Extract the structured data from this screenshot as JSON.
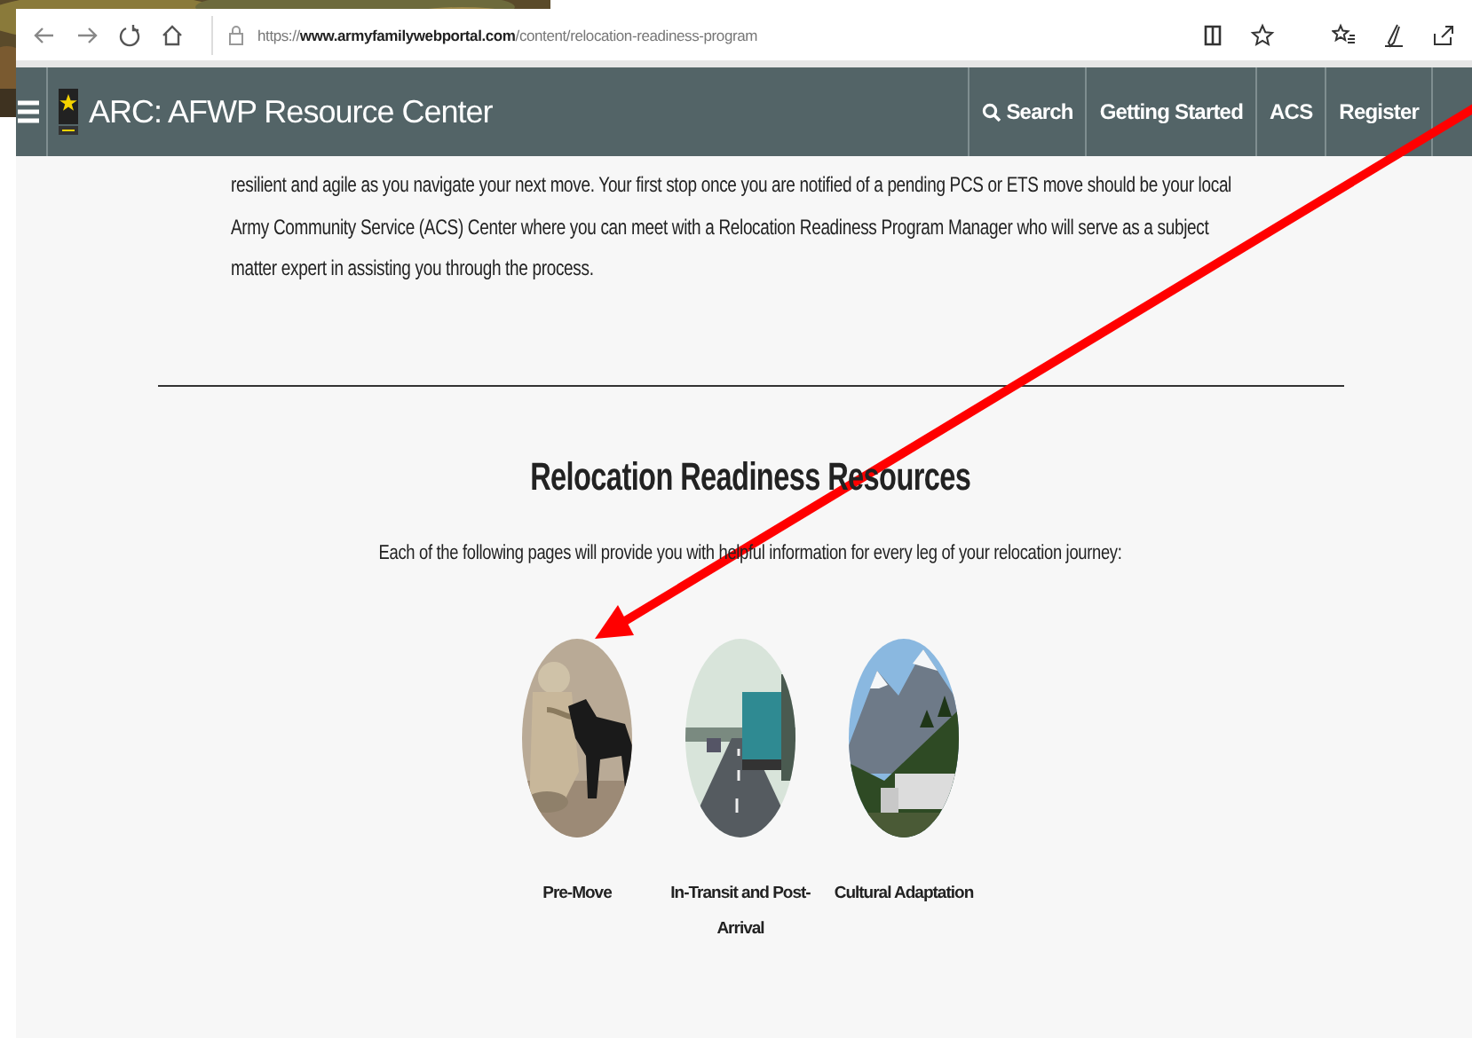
{
  "browser": {
    "url": "https://**www.armyfamilywebportal.com**/content/relocation-readiness-program"
  },
  "nav": {
    "title": "ARC: AFWP Resource Center",
    "links": [
      {
        "label": "Search",
        "kind": "search"
      },
      {
        "label": "Getting Started",
        "kind": "link"
      },
      {
        "label": "ACS",
        "kind": "link"
      },
      {
        "label": "Register",
        "kind": "link"
      }
    ]
  },
  "content": {
    "intro": "resilient and agile as you navigate your next move. Your first stop once you are notified of a pending PCS or ETS move should be your local Army Community Service (ACS) Center where you can meet with a Relocation Readiness Program Manager who will serve as a subject matter expert in assisting you through the process.",
    "heading": "Relocation Readiness Resources",
    "subheading": "Each of the following pages will provide you with helpful information for every leg of your relocation journey:",
    "resources": [
      {
        "label": "Pre-Move",
        "kind": "picture"
      },
      {
        "label": "In-Transit and Post-Arrival",
        "kind": "picture"
      },
      {
        "label": "Cultural Adaptation",
        "kind": "picture"
      }
    ]
  }
}
